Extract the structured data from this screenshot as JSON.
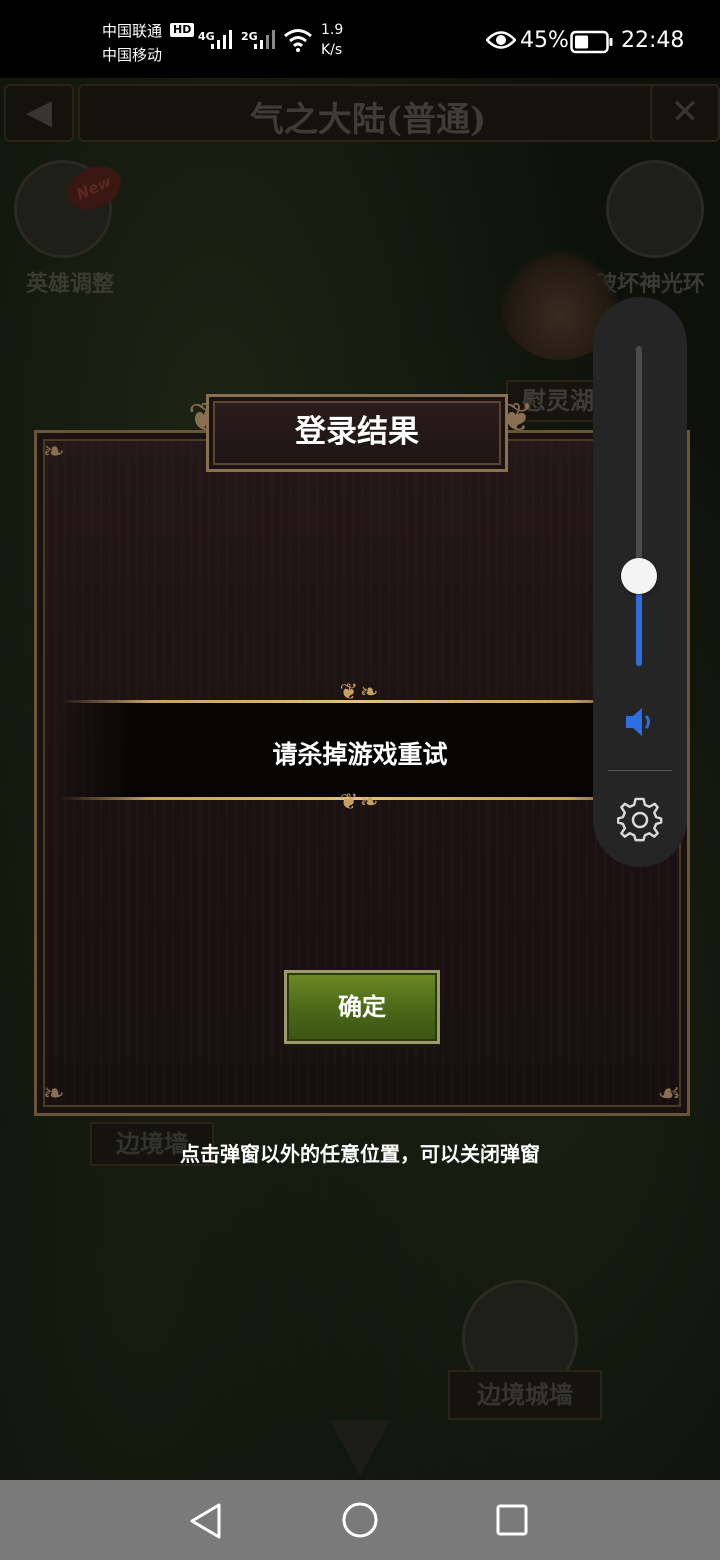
{
  "status_bar": {
    "carrier_1": "中国联通",
    "carrier_2": "中国移动",
    "hd_badge": "HD",
    "network_1": "4G",
    "network_2": "2G",
    "speed_value": "1.9",
    "speed_unit": "K/s",
    "battery_percent": "45%",
    "battery_level": 0.45,
    "time": "22:48"
  },
  "background": {
    "map_title": "气之大陆(普通)",
    "back_glyph": "◀",
    "close_glyph": "✕",
    "hero_label": "英雄调整",
    "hero_badge": "New",
    "halo_label": "破坏神光环",
    "spirit_lake_label": "慰灵湖",
    "border_label_1": "边境墙",
    "border_label_2": "边境城墙"
  },
  "dialog": {
    "title": "登录结果",
    "message": "请杀掉游戏重试",
    "confirm_label": "确定",
    "close_hint": "点击弹窗以外的任意位置，可以关闭弹窗",
    "ornament": "❦❧"
  },
  "volume_panel": {
    "level": 0.28,
    "accent_color": "#2d6fe0"
  },
  "icons": {
    "speaker": "speaker-icon",
    "settings": "gear-icon",
    "eye": "eye-icon",
    "wifi": "wifi-icon",
    "nav_back": "nav-back-icon",
    "nav_home": "nav-home-icon",
    "nav_recent": "nav-recent-icon"
  }
}
